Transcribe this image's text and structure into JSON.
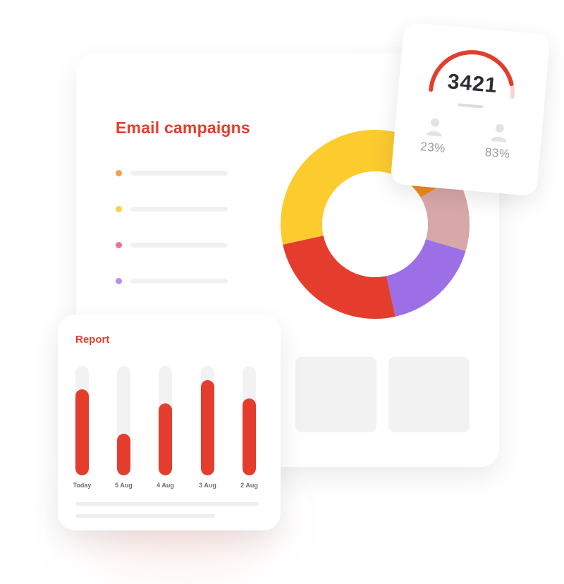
{
  "colors": {
    "accent": "#e43d2e",
    "orange": "#f08a1f",
    "yellow": "#fccb2e",
    "pink": "#e97590",
    "purple": "#9c6fe6",
    "rose": "#d8a8a8"
  },
  "campaigns": {
    "title": "Email campaigns",
    "legend": [
      {
        "color": "#f0a050"
      },
      {
        "color": "#fcd04a"
      },
      {
        "color": "#e97590"
      },
      {
        "color": "#b48ef0"
      }
    ]
  },
  "donut": {
    "segments": [
      {
        "color": "#f08a1f",
        "value": 11
      },
      {
        "color": "#d8a8a8",
        "value": 13
      },
      {
        "color": "#9c6fe6",
        "value": 17
      },
      {
        "color": "#e43d2e",
        "value": 25
      },
      {
        "color": "#fccb2e",
        "value": 34
      }
    ]
  },
  "stats": {
    "value": "3421",
    "gauge_fraction": 0.9,
    "left_pct": "23%",
    "right_pct": "83%",
    "icons": [
      "user-icon",
      "user-icon"
    ]
  },
  "chart_data": {
    "type": "bar",
    "title": "Report",
    "categories": [
      "Today",
      "5 Aug",
      "4 Aug",
      "3 Aug",
      "2 Aug"
    ],
    "values": [
      79,
      38,
      66,
      87,
      70
    ],
    "ylim": [
      0,
      100
    ],
    "color": "#e43d2e"
  }
}
